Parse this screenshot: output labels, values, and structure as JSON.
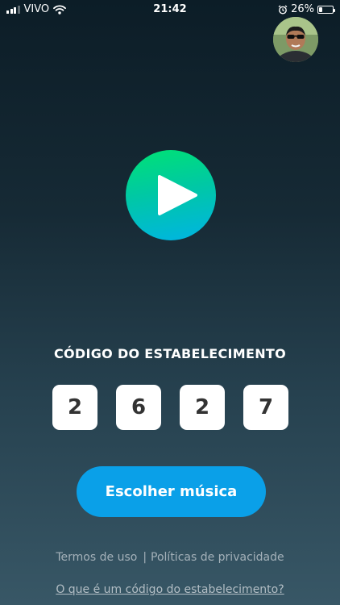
{
  "status_bar": {
    "carrier": "VIVO",
    "time": "21:42",
    "battery": "26%",
    "battery_level": 0.26,
    "icons": [
      "signal-icon",
      "wifi-icon",
      "alarm-icon",
      "battery-icon"
    ]
  },
  "profile": {
    "avatar": "user-avatar"
  },
  "player": {
    "icon": "play-icon"
  },
  "establishment": {
    "title": "CÓDIGO DO ESTABELECIMENTO",
    "digits": [
      "2",
      "6",
      "2",
      "7"
    ]
  },
  "actions": {
    "choose_music_label": "Escolher música"
  },
  "footer": {
    "terms_label": "Termos de uso",
    "separator": "|",
    "privacy_label": "Políticas de privacidade",
    "help_link": "O que é um código do estabelecimento?"
  },
  "colors": {
    "accent": "#0aa0e8",
    "play_gradient_top": "#00e274",
    "play_gradient_bottom": "#00b4e4"
  }
}
